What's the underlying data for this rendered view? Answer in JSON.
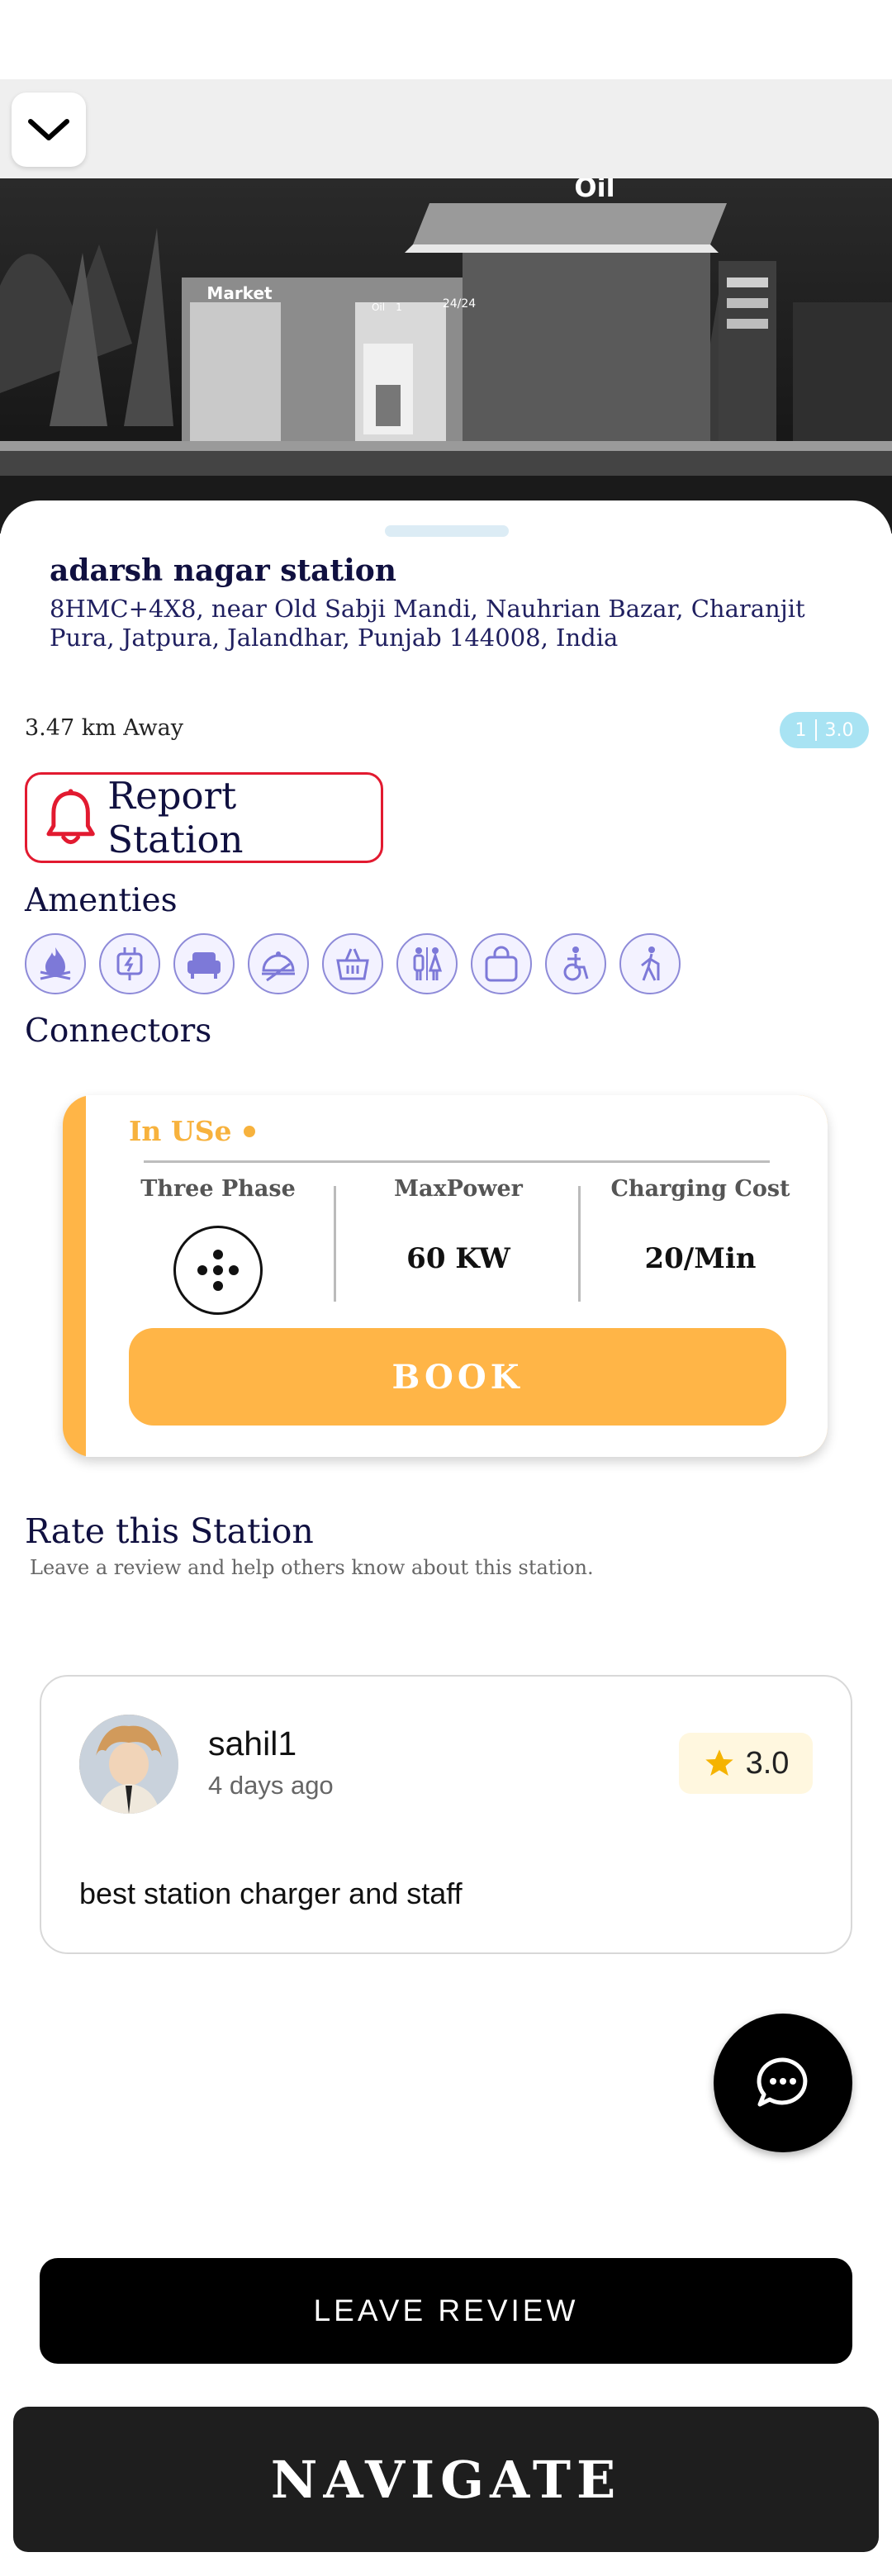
{
  "hero": {
    "signs": {
      "oil": "Oil",
      "market": "Market",
      "hours": "24/24",
      "pump_oil": "Oil",
      "pump_no": "1"
    }
  },
  "station": {
    "name": "adarsh nagar station",
    "address": "8HMC+4X8, near Old Sabji Mandi, Nauhrian Bazar, Charanjit Pura, Jatpura, Jalandhar, Punjab 144008, India",
    "distance": "3.47 km Away",
    "rating_count": "1",
    "rating_value": "3.0"
  },
  "report": {
    "label": "Report Station",
    "color": "#e21a30"
  },
  "amenities": {
    "title": "Amenties",
    "icons": [
      "fire-icon",
      "charging-plug-icon",
      "sofa-icon",
      "food-cloche-icon",
      "shopping-basket-icon",
      "restroom-icon",
      "shopping-bag-icon",
      "wheelchair-icon",
      "walking-assist-icon"
    ]
  },
  "connectors": {
    "title": "Connectors",
    "status": "In USe",
    "type_label": "Three Phase",
    "max_power_label": "MaxPower",
    "max_power_value": "60 KW",
    "cost_label": "Charging Cost",
    "cost_value": "20/Min",
    "book_label": "BOOK",
    "accent": "#ffb547"
  },
  "rate": {
    "title": "Rate this Station",
    "subtitle": "Leave a review and help others know about this station."
  },
  "review": {
    "user": "sahil1",
    "time": "4 days ago",
    "rating": "3.0",
    "text": "best station charger and staff",
    "star_color": "#f5b300"
  },
  "actions": {
    "leave_review": "LEAVE REVIEW",
    "navigate": "NAVIGATE"
  }
}
